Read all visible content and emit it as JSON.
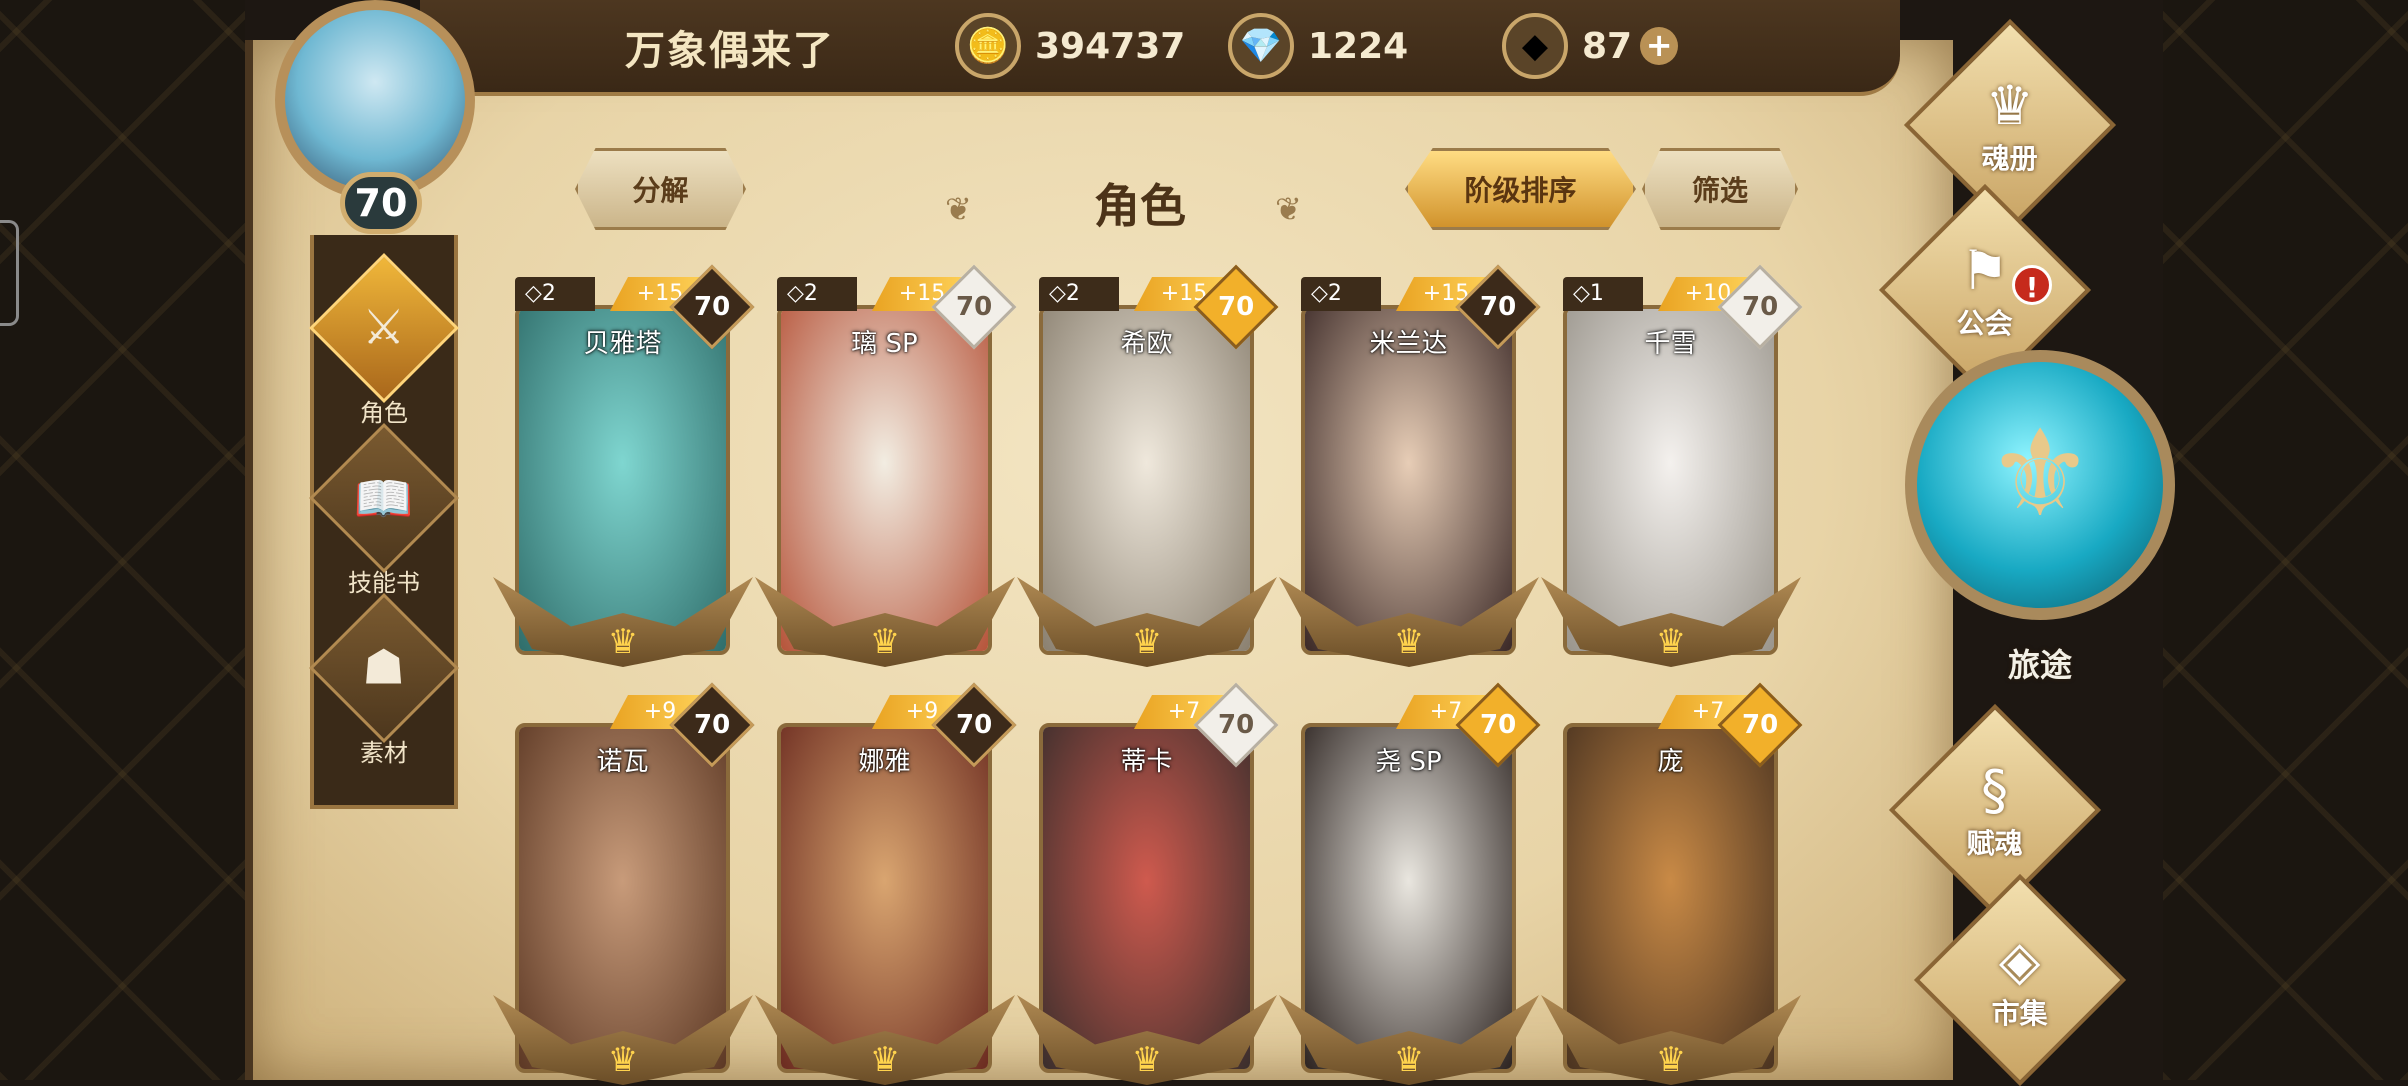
{
  "header": {
    "player_name": "万象偶来了",
    "avatar_level": "70",
    "currencies": [
      {
        "name": "gold-coin-icon",
        "value": "394737"
      },
      {
        "name": "blue-crystal-icon",
        "value": "1224"
      },
      {
        "name": "soul-stone-icon",
        "value": "87"
      }
    ],
    "plus_label": "+"
  },
  "left_nav": [
    {
      "label": "角色",
      "icon": "character-helmet-icon",
      "active": true
    },
    {
      "label": "技能书",
      "icon": "skill-book-icon",
      "active": false
    },
    {
      "label": "素材",
      "icon": "material-icon",
      "active": false
    }
  ],
  "toolbar": {
    "decompose_label": "分解",
    "section_title": "角色",
    "sort_label": "阶级排序",
    "filter_label": "筛选"
  },
  "characters": [
    {
      "name": "贝雅塔",
      "tier": "◇2",
      "plus": "+15",
      "level": "70",
      "badge": "dark",
      "colors": [
        "#7fd6d0",
        "#2f6d6a"
      ]
    },
    {
      "name": "璃 SP",
      "tier": "◇2",
      "plus": "+15",
      "level": "70",
      "badge": "white",
      "colors": [
        "#f2ede2",
        "#b6543a"
      ]
    },
    {
      "name": "希欧",
      "tier": "◇2",
      "plus": "+15",
      "level": "70",
      "badge": "gold",
      "colors": [
        "#efe8dc",
        "#8a8070"
      ]
    },
    {
      "name": "米兰达",
      "tier": "◇2",
      "plus": "+15",
      "level": "70",
      "badge": "dark",
      "colors": [
        "#e7cdb6",
        "#3a2826"
      ]
    },
    {
      "name": "千雪",
      "tier": "◇1",
      "plus": "+10",
      "level": "70",
      "badge": "white",
      "colors": [
        "#f4f1ee",
        "#9a958c"
      ]
    },
    {
      "name": "诺瓦",
      "tier": "",
      "plus": "+9",
      "level": "70",
      "badge": "dark",
      "colors": [
        "#c89b7a",
        "#5c3824"
      ]
    },
    {
      "name": "娜雅",
      "tier": "",
      "plus": "+9",
      "level": "70",
      "badge": "dark",
      "colors": [
        "#d9a570",
        "#6b2b20"
      ]
    },
    {
      "name": "蒂卡",
      "tier": "",
      "plus": "+7",
      "level": "70",
      "badge": "white",
      "colors": [
        "#cf5a4e",
        "#3a2e2c"
      ]
    },
    {
      "name": "尧 SP",
      "tier": "",
      "plus": "+7",
      "level": "70",
      "badge": "gold",
      "colors": [
        "#e9e6df",
        "#2c2320"
      ]
    },
    {
      "name": "庞",
      "tier": "",
      "plus": "+7",
      "level": "70",
      "badge": "gold",
      "colors": [
        "#c98a46",
        "#4a3320"
      ]
    }
  ],
  "right_menu": [
    {
      "label": "魂册",
      "icon": "soul-book-icon"
    },
    {
      "label": "公会",
      "icon": "guild-banner-icon",
      "alert": "!"
    },
    {
      "label": "旅途",
      "icon": "journey-emblem-icon"
    },
    {
      "label": "赋魂",
      "icon": "soul-flame-icon"
    },
    {
      "label": "市集",
      "icon": "market-gem-icon"
    }
  ],
  "colors": {
    "parchment": "#e8d4a7",
    "gold": "#f2b02a",
    "dark_wood": "#3a2816"
  }
}
